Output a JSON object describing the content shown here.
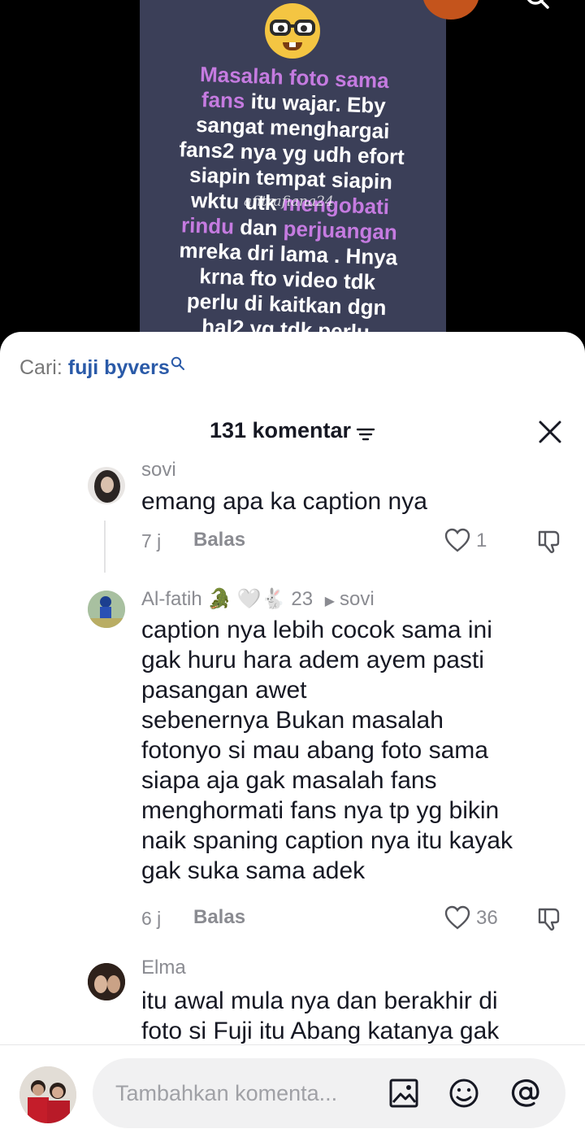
{
  "video": {
    "overlay_text_lines": [
      {
        "parts": [
          {
            "t": "Masalah foto sama",
            "hl": true
          }
        ]
      },
      {
        "parts": [
          {
            "t": "fans",
            "hl": true
          },
          {
            "t": " itu wajar. Eby",
            "hl": false
          }
        ]
      },
      {
        "parts": [
          {
            "t": "sangat menghargai",
            "hl": false
          }
        ]
      },
      {
        "parts": [
          {
            "t": "fans2 nya yg udh efort",
            "hl": false
          }
        ]
      },
      {
        "parts": [
          {
            "t": "siapin tempat siapin",
            "hl": false
          }
        ]
      },
      {
        "parts": [
          {
            "t": "wktu utk ",
            "hl": false
          },
          {
            "t": "mengobati",
            "hl": true
          }
        ]
      },
      {
        "parts": [
          {
            "t": "rindu",
            "hl": true
          },
          {
            "t": " dan ",
            "hl": false
          },
          {
            "t": "perjuangan",
            "hl": true
          }
        ]
      },
      {
        "parts": [
          {
            "t": "mreka dri lama . Hnya",
            "hl": false
          }
        ]
      },
      {
        "parts": [
          {
            "t": "krna fto video tdk",
            "hl": false
          }
        ]
      },
      {
        "parts": [
          {
            "t": "perlu di kaitkan dgn",
            "hl": false
          }
        ]
      },
      {
        "parts": [
          {
            "t": "hal2 yg tdk perlu",
            "hl": false
          }
        ]
      }
    ],
    "watermark": "afitrafiana24"
  },
  "search": {
    "prefix": "Cari:",
    "term": "fuji byvers"
  },
  "header": {
    "count_label": "131 komentar"
  },
  "comments": [
    {
      "username": "sovi",
      "text": "emang apa ka caption nya",
      "time": "7 j",
      "reply_label": "Balas",
      "likes": "1"
    },
    {
      "username": "Al-fatih 🐊 🤍🐇 23",
      "reply_to": "sovi",
      "text_lines": [
        "caption nya lebih cocok sama ini",
        "gak huru hara adem ayem pasti",
        "pasangan awet",
        "sebenernya Bukan masalah",
        "fotonyo si mau abang foto sama",
        "siapa aja gak masalah fans",
        "menghormati fans nya tp yg bikin",
        "naik spaning caption nya itu kayak",
        "gak suka sama adek"
      ],
      "time": "6 j",
      "reply_label": "Balas",
      "likes": "36"
    },
    {
      "username": "Elma",
      "text_lines": [
        "itu awal mula nya dan berakhir di",
        "foto si Fuji itu Abang katanya gak"
      ]
    }
  ],
  "composer": {
    "placeholder": "Tambahkan komenta..."
  },
  "colors": {
    "accent_link": "#2a5aa8",
    "text_primary": "#161823",
    "text_secondary": "#8a8b91",
    "highlight_purple": "#c57be0"
  }
}
